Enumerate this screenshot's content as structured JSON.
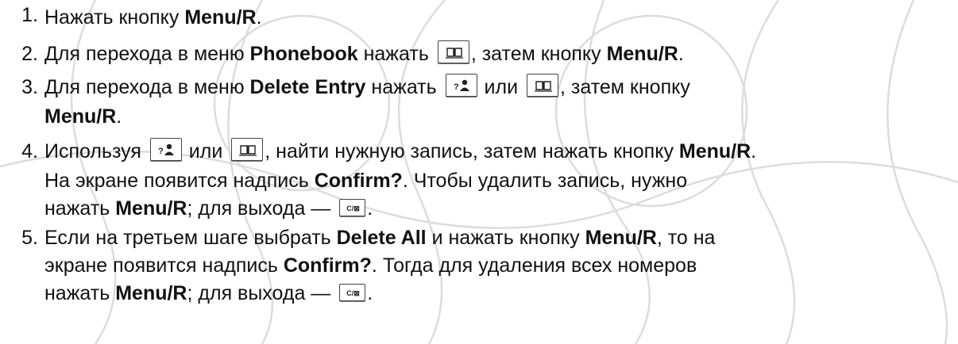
{
  "steps": [
    {
      "number": "1.",
      "lines": [
        {
          "parts": [
            "Нажать кнопку ",
            "Menu/R",
            "."
          ]
        }
      ]
    },
    {
      "number": "2.",
      "lines": [
        {
          "parts": [
            "Для перехода в меню ",
            "Phonebook",
            " нажать ",
            ", затем кнопку ",
            "Menu/R",
            "."
          ]
        }
      ]
    },
    {
      "number": "3.",
      "lines": [
        {
          "parts": [
            "Для перехода в меню ",
            "Delete Entry",
            " нажать ",
            " или ",
            ", затем кнопку"
          ]
        },
        {
          "parts": [
            "Menu/R",
            "."
          ]
        }
      ]
    },
    {
      "number": "4.",
      "lines": [
        {
          "parts": [
            "Используя ",
            " или ",
            ", найти нужную запись, затем нажать кнопку ",
            "Menu/R",
            "."
          ]
        },
        {
          "parts": [
            "На экране появится надпись ",
            "Confirm?",
            ". Чтобы удалить запись, нужно"
          ]
        },
        {
          "parts": [
            "нажать ",
            "Menu/R",
            "; для выхода — ",
            "."
          ]
        }
      ]
    },
    {
      "number": "5.",
      "lines": [
        {
          "parts": [
            "Если на третьем шаге выбрать ",
            "Delete All",
            " и нажать кнопку ",
            "Menu/R",
            ", то на"
          ]
        },
        {
          "parts": [
            "экране появится надпись ",
            "Confirm?",
            ". Тогда для удаления всех номеров"
          ]
        },
        {
          "parts": [
            "нажать ",
            "Menu/R",
            "; для выхода — ",
            "."
          ]
        }
      ]
    }
  ],
  "keys": {
    "phonebook_icon": "phonebook-book-icon",
    "redial_icon": "redial-person-icon",
    "clear_label": "C/⊠",
    "redial_label": "?"
  },
  "colors": {
    "text": "#111111",
    "watermark": "#dcdcdc"
  }
}
